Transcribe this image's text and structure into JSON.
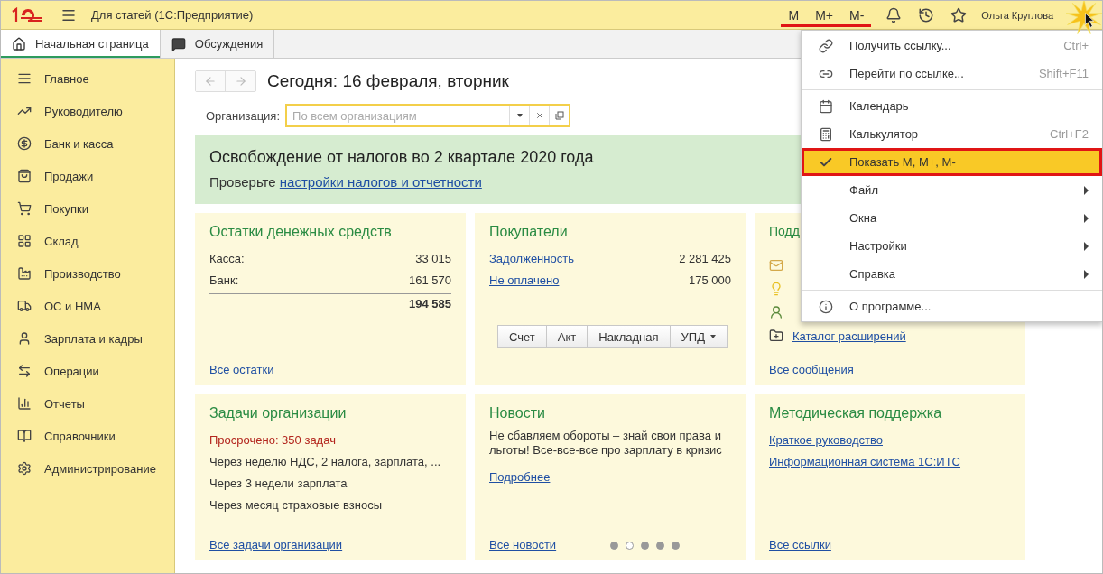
{
  "window": {
    "title": "Для статей  (1С:Предприятие)"
  },
  "memory_buttons": [
    {
      "label": "M"
    },
    {
      "label": "M+"
    },
    {
      "label": "M-"
    }
  ],
  "user": "Ольга Круглова",
  "tabs": [
    {
      "label": "Начальная страница",
      "selected": true
    },
    {
      "label": "Обсуждения",
      "selected": false
    }
  ],
  "sidebar": {
    "items": [
      {
        "label": "Главное"
      },
      {
        "label": "Руководителю"
      },
      {
        "label": "Банк и касса"
      },
      {
        "label": "Продажи"
      },
      {
        "label": "Покупки"
      },
      {
        "label": "Склад"
      },
      {
        "label": "Производство"
      },
      {
        "label": "ОС и НМА"
      },
      {
        "label": "Зарплата и кадры"
      },
      {
        "label": "Операции"
      },
      {
        "label": "Отчеты"
      },
      {
        "label": "Справочники"
      },
      {
        "label": "Администрирование"
      }
    ]
  },
  "header": {
    "title": "Сегодня: 16 февраля, вторник",
    "org_label": "Организация:",
    "org_placeholder": "По всем организациям"
  },
  "banner": {
    "title": "Освобождение от налогов во 2 квартале 2020 года",
    "text": "Проверьте ",
    "link": "настройки налогов и отчетности"
  },
  "money": {
    "title": "Остатки денежных средств",
    "rows": [
      {
        "label": "Касса:",
        "value": "33 015"
      },
      {
        "label": "Банк:",
        "value": "161 570"
      }
    ],
    "total": "194 585",
    "link": "Все остатки"
  },
  "customers": {
    "title": "Покупатели",
    "rows": [
      {
        "label": "Задолженность",
        "value": "2 281 425"
      },
      {
        "label": "Не оплачено",
        "value": "175 000"
      }
    ],
    "buttons": [
      {
        "label": "Счет",
        "kind": "plain"
      },
      {
        "label": "Акт",
        "kind": "plain"
      },
      {
        "label": "Накладная",
        "kind": "plain"
      },
      {
        "label": "УПД",
        "kind": "dropdown"
      }
    ]
  },
  "support": {
    "title": "Подд",
    "last_link": "Каталог расширений",
    "link": "Все сообщения"
  },
  "tasks": {
    "title": "Задачи организации",
    "overdue": "Просрочено: 350 задач",
    "items": [
      "Через неделю НДС, 2 налога, зарплата, ...",
      "Через 3 недели зарплата",
      "Через месяц страховые взносы"
    ],
    "link": "Все задачи организации"
  },
  "news": {
    "title": "Новости",
    "text": "Не сбавляем обороты – знай свои права и льготы! Все-все-все про зарплату в кризис",
    "more": "Подробнее",
    "link": "Все новости",
    "pages": [
      {
        "selected": false
      },
      {
        "selected": true
      },
      {
        "selected": false
      },
      {
        "selected": false
      },
      {
        "selected": false
      }
    ]
  },
  "methods": {
    "title": "Методическая поддержка",
    "links": [
      "Краткое руководство",
      "Информационная система 1С:ИТС"
    ],
    "link": "Все ссылки"
  },
  "menu": {
    "groups": [
      [
        {
          "kind": "action",
          "label": "Получить ссылку...",
          "shortcut": "Ctrl+",
          "selected": false
        },
        {
          "kind": "action",
          "label": "Перейти по ссылке...",
          "shortcut": "Shift+F11",
          "selected": false
        }
      ],
      [
        {
          "kind": "action",
          "label": "Календарь",
          "selected": false
        },
        {
          "kind": "action",
          "label": "Калькулятор",
          "shortcut": "Ctrl+F2",
          "selected": false
        },
        {
          "kind": "check",
          "label": "Показать M, M+, M-",
          "checked": true,
          "selected": true
        },
        {
          "kind": "submenu",
          "label": "Файл",
          "selected": false
        },
        {
          "kind": "submenu",
          "label": "Окна",
          "selected": false
        },
        {
          "kind": "submenu",
          "label": "Настройки",
          "selected": false
        },
        {
          "kind": "submenu",
          "label": "Справка",
          "selected": false
        }
      ],
      [
        {
          "kind": "action",
          "label": "О программе...",
          "selected": false
        }
      ]
    ]
  }
}
